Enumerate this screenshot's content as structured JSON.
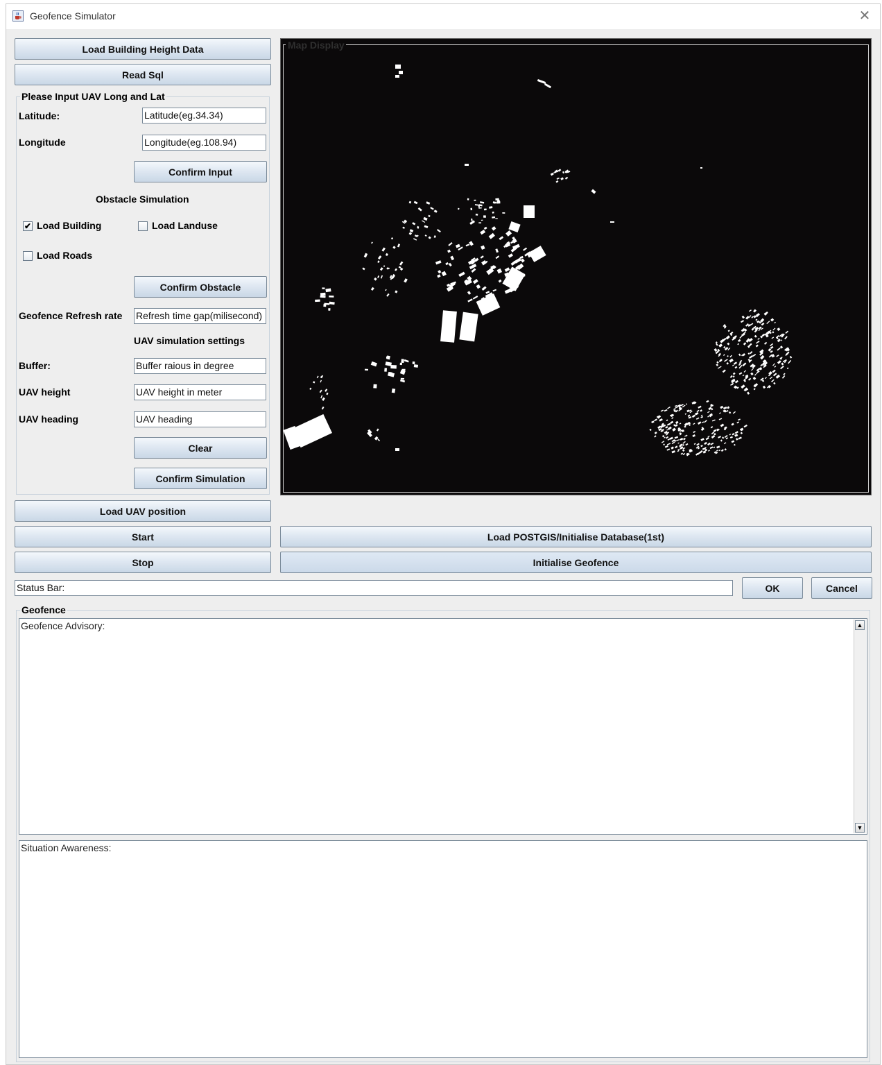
{
  "window": {
    "title": "Geofence Simulator",
    "close_glyph": "✕",
    "app_icon": "java-cup-icon"
  },
  "left": {
    "load_building_height": "Load Building Height Data",
    "read_sql": "Read Sql",
    "input_group_title": "Please Input UAV Long and Lat",
    "latitude_label": "Latitude:",
    "latitude_value": "Latitude(eg.34.34)",
    "longitude_label": "Longitude",
    "longitude_value": "Longitude(eg.108.94)",
    "confirm_input": "Confirm Input",
    "obstacle_title": "Obstacle Simulation",
    "load_building": "Load Building",
    "load_building_checked": true,
    "load_landuse": "Load Landuse",
    "load_landuse_checked": false,
    "load_roads": "Load Roads",
    "load_roads_checked": false,
    "confirm_obstacle": "Confirm Obstacle",
    "refresh_label": "Geofence Refresh rate",
    "refresh_value": "Refresh time gap(milisecond)",
    "uav_settings_title": "UAV simulation settings",
    "buffer_label": "Buffer:",
    "buffer_value": "Buffer raious in degree",
    "height_label": "UAV height",
    "height_value": "UAV height in meter",
    "heading_label": "UAV heading",
    "heading_value": "UAV heading",
    "clear": "Clear",
    "confirm_simulation": "Confirm Simulation",
    "load_uav_position": "Load UAV position",
    "start": "Start",
    "stop": "Stop"
  },
  "map": {
    "title": "Map Display",
    "background": "#0b090a",
    "feature_color": "#ffffff"
  },
  "right": {
    "load_postgis": "Load POSTGIS/Initialise Database(1st)",
    "initialise_geofence": "Initialise Geofence"
  },
  "status": {
    "value": "Status Bar:",
    "ok": "OK",
    "cancel": "Cancel"
  },
  "geofence": {
    "group_title": "Geofence",
    "advisory": "Geofence Advisory:",
    "situation": "Situation Awareness:"
  }
}
